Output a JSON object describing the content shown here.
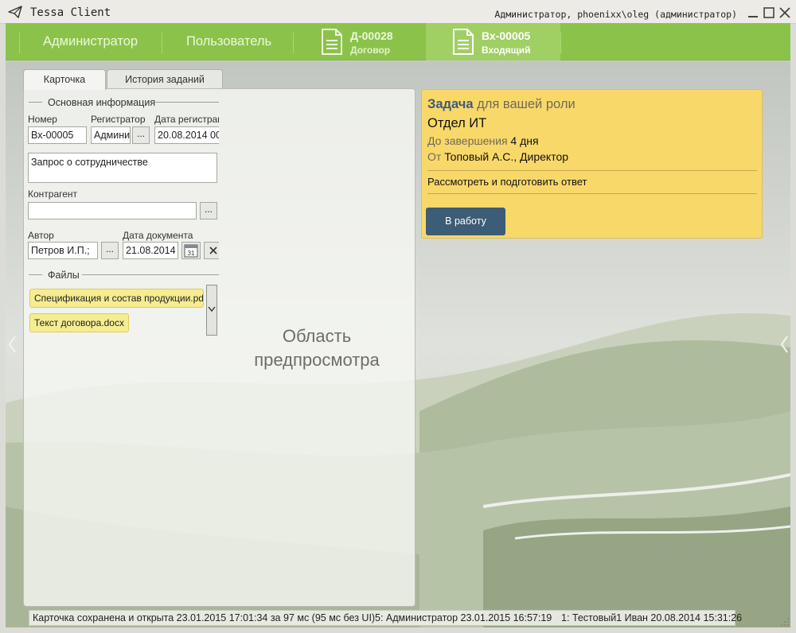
{
  "window": {
    "title": "Tessa Client",
    "user": "Администратор, phoenixx\\oleg (администратор)"
  },
  "nav": {
    "admin_label": "Администратор",
    "user_label": "Пользователь",
    "docs": [
      {
        "number": "Д-00028",
        "type": "Договор"
      },
      {
        "number": "Вх-00005",
        "type": "Входящий"
      }
    ]
  },
  "tabs": {
    "card": "Карточка",
    "history": "История заданий"
  },
  "form": {
    "main_group": "Основная информация",
    "number_label": "Номер",
    "number_value": "Вх-00005",
    "registrar_label": "Регистратор",
    "registrar_value": "Админи",
    "reg_date_label": "Дата регистрации",
    "reg_date_value": "20.08.2014  00",
    "dots": "...",
    "subject_value": "Запрос о сотрудничестве",
    "counterparty_label": "Контрагент",
    "counterparty_value": "",
    "author_label": "Автор",
    "author_value": "Петров И.П.;",
    "doc_date_label": "Дата документа",
    "doc_date_value": "21.08.2014",
    "calendar_day": "31",
    "files_group": "Файлы",
    "files": [
      "Спецификация и состав продукции.pdf",
      "Текст договора.docx"
    ]
  },
  "preview": {
    "line1": "Область",
    "line2": "предпросмотра"
  },
  "task": {
    "title_bold": "Задача",
    "title_rest": " для вашей роли",
    "department": "Отдел ИТ",
    "due_label": "До завершения",
    "due_value": "4 дня",
    "from_label": "От",
    "from_value": "Топовый А.С., Директор",
    "description": "Рассмотреть и подготовить ответ",
    "action_button": "В работу"
  },
  "status": {
    "saved": "Карточка сохранена и открыта 23.01.2015 17:01:34 за 97 мс (95 мс без UI)",
    "item5": "5:  Администратор  23.01.2015 16:57:19",
    "item1": "1:  Тестовый1 Иван  20.08.2014 15:31:26"
  },
  "colors": {
    "nav_green": "#8bc34a",
    "nav_active": "#a0cf63",
    "task_yellow": "#f9d86a",
    "button_blue": "#3d5c75",
    "file_chip": "#f6ec91"
  }
}
